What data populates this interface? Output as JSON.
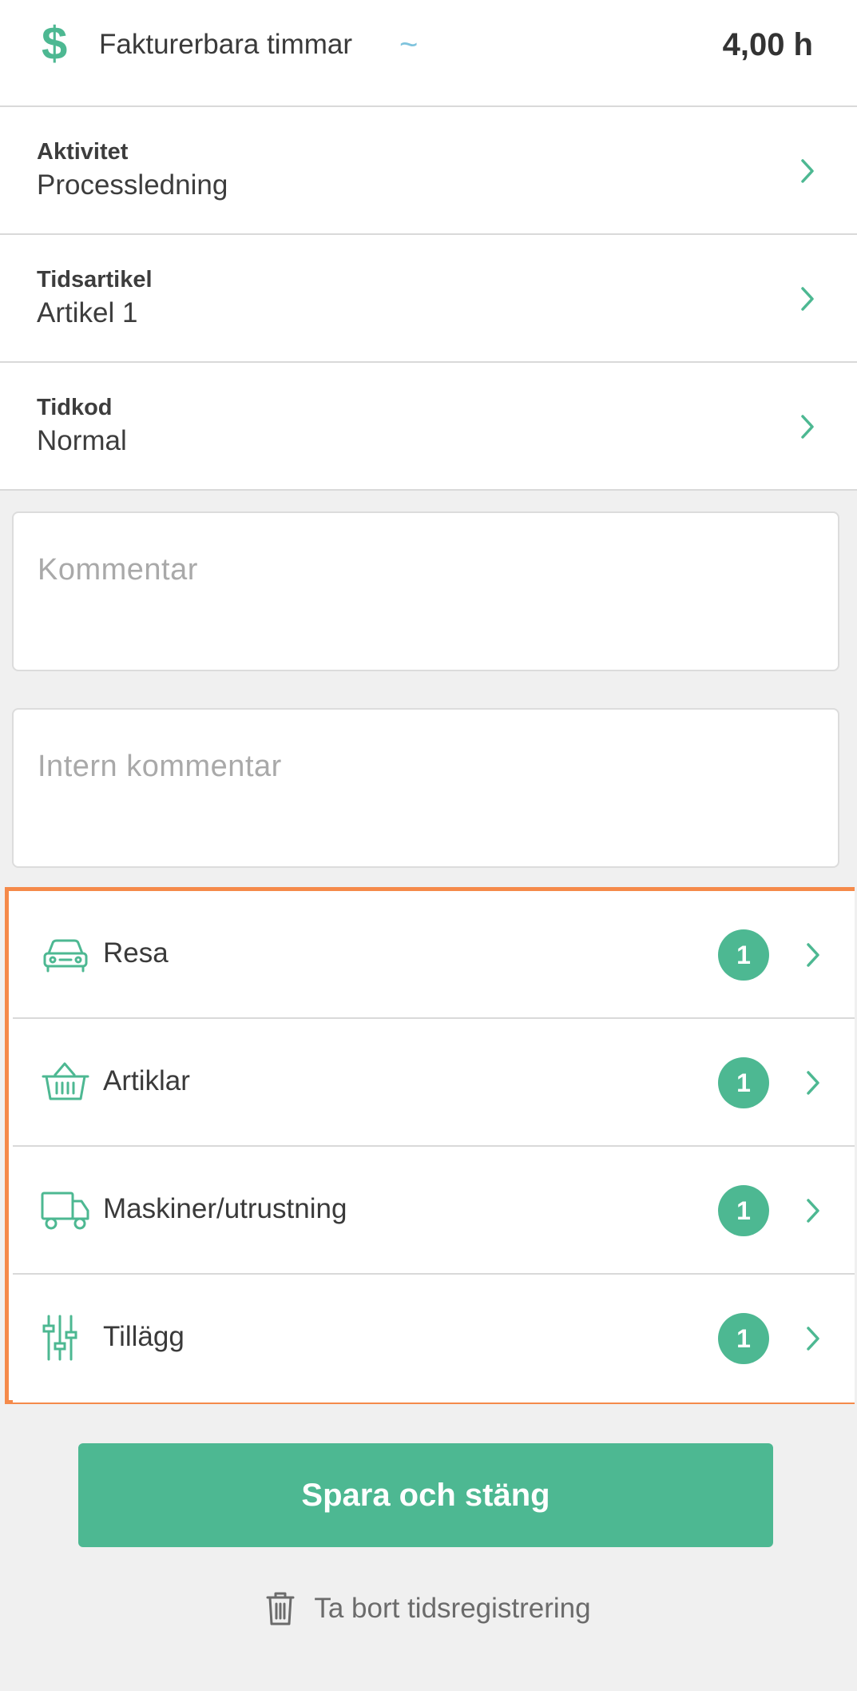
{
  "billable": {
    "icon": "dollar-icon",
    "symbol": "$",
    "label": "Fakturerbara timmar",
    "wave_icon": "~",
    "value": "4,00 h"
  },
  "fields": [
    {
      "label": "Aktivitet",
      "value": "Processledning"
    },
    {
      "label": "Tidsartikel",
      "value": "Artikel 1"
    },
    {
      "label": "Tidkod",
      "value": "Normal"
    }
  ],
  "comment": {
    "placeholder": "Kommentar"
  },
  "internal_comment": {
    "placeholder": "Intern kommentar"
  },
  "extras": [
    {
      "icon": "car-icon",
      "label": "Resa",
      "count": "1"
    },
    {
      "icon": "basket-icon",
      "label": "Artiklar",
      "count": "1"
    },
    {
      "icon": "truck-icon",
      "label": "Maskiner/utrustning",
      "count": "1"
    },
    {
      "icon": "sliders-icon",
      "label": "Tillägg",
      "count": "1"
    }
  ],
  "actions": {
    "save_label": "Spara och stäng",
    "delete_label": "Ta bort tidsregistrering"
  },
  "colors": {
    "accent": "#4db892",
    "highlight": "#f58a4a",
    "background": "#f0f0f0"
  }
}
